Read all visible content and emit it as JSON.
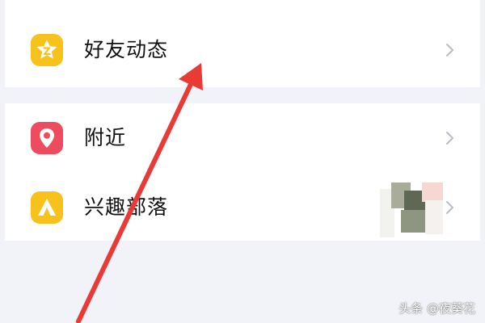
{
  "menu": {
    "items": [
      {
        "label": "好友动态",
        "icon": "star-icon",
        "icon_color": "#f8c21c"
      },
      {
        "label": "附近",
        "icon": "location-pin-icon",
        "icon_color": "#ef4b5e"
      },
      {
        "label": "兴趣部落",
        "icon": "tent-icon",
        "icon_color": "#f9c21b"
      }
    ]
  },
  "annotation": {
    "arrow_color": "#ea3a35"
  },
  "watermark": {
    "text": "头条 @夜葵花"
  },
  "colors": {
    "background": "#f2f3f8",
    "card": "#ffffff",
    "chevron": "#b9bcc4"
  }
}
